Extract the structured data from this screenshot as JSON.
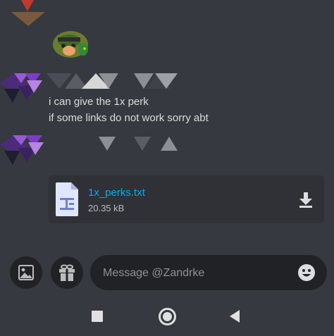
{
  "chat": {
    "messages": [
      {
        "lines": [
          "i can give the 1x perk",
          "if some links do not work sorry abt"
        ]
      }
    ],
    "attachment": {
      "file_name": "1x_perks.txt",
      "file_size": "20.35 kB",
      "icon": "text-file-icon",
      "action_icon": "download-icon"
    }
  },
  "composer": {
    "placeholder": "Message @Zandrke",
    "left_buttons": [
      "image-icon",
      "gift-icon"
    ],
    "right_icon": "emoji-icon"
  },
  "navbar": {
    "buttons": [
      "recents-square-icon",
      "home-circle-icon",
      "back-triangle-icon"
    ]
  },
  "colors": {
    "background": "#36393f",
    "input_background": "#202225",
    "attachment_background": "#2f3136",
    "link": "#00aff4",
    "text": "#dcddde",
    "muted": "#8e9297"
  }
}
